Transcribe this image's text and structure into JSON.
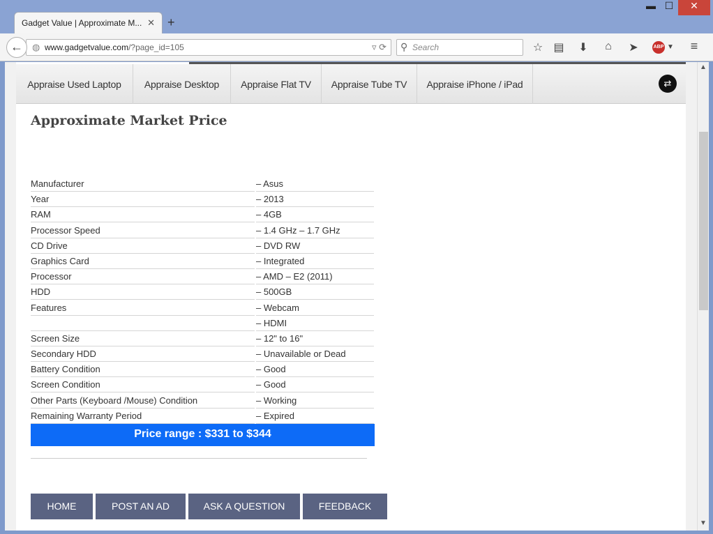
{
  "browser": {
    "tab_title": "Gadget Value | Approximate M...",
    "tab_close": "✕",
    "new_tab": "+",
    "window_controls": {
      "minimize": "▬",
      "maximize": "☐",
      "close": "✕"
    },
    "url_domain": "www.gadgetvalue.com",
    "url_path": "/?page_id=105",
    "search_placeholder": "Search",
    "toolbar_icons": [
      "bookmark-star-icon",
      "reading-list-icon",
      "download-icon",
      "home-icon",
      "send-icon",
      "adblock-icon",
      "menu-icon"
    ],
    "abp_label": "ABP"
  },
  "menu": {
    "items": [
      {
        "label": "Appraise Used Laptop"
      },
      {
        "label": "Appraise Desktop"
      },
      {
        "label": "Appraise Flat TV"
      },
      {
        "label": "Appraise Tube TV"
      },
      {
        "label": "Appraise iPhone / iPad"
      }
    ]
  },
  "page": {
    "title": "Approximate Market Price",
    "specs": [
      {
        "label": "Manufacturer",
        "value": "– Asus"
      },
      {
        "label": "Year",
        "value": "– 2013"
      },
      {
        "label": "RAM",
        "value": "– 4GB"
      },
      {
        "label": "Processor Speed",
        "value": "– 1.4 GHz – 1.7 GHz"
      },
      {
        "label": "CD Drive",
        "value": "– DVD RW"
      },
      {
        "label": "Graphics Card",
        "value": "– Integrated"
      },
      {
        "label": "Processor",
        "value": "– AMD – E2 (2011)"
      },
      {
        "label": "HDD",
        "value": "– 500GB"
      },
      {
        "label": "Features",
        "value": "– Webcam"
      },
      {
        "label": "",
        "value": "– HDMI"
      },
      {
        "label": "Screen Size",
        "value": "– 12\" to 16\""
      },
      {
        "label": "Secondary HDD",
        "value": "– Unavailable or Dead"
      },
      {
        "label": "Battery Condition",
        "value": "– Good"
      },
      {
        "label": "Screen Condition",
        "value": "– Good"
      },
      {
        "label": "Other Parts (Keyboard /Mouse) Condition",
        "value": "– Working"
      },
      {
        "label": "Remaining Warranty Period",
        "value": "– Expired"
      }
    ],
    "price_range": "Price range : $331 to $344",
    "price_color": "#0d6bf7"
  },
  "footer": {
    "buttons": [
      {
        "label": "HOME"
      },
      {
        "label": "POST AN AD"
      },
      {
        "label": "ASK A QUESTION"
      },
      {
        "label": "FEEDBACK"
      }
    ]
  }
}
